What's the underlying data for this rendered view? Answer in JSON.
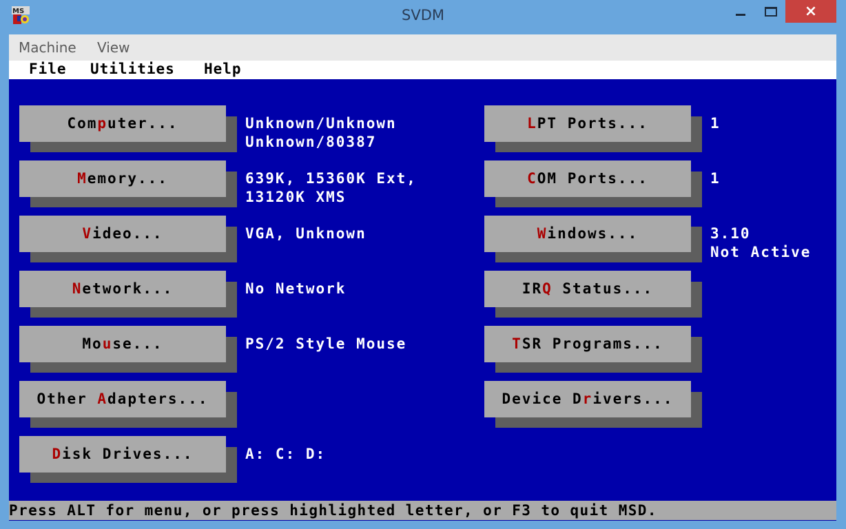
{
  "window": {
    "title": "SVDM",
    "icon": "msd-app-icon",
    "controls": {
      "minimize": "minimize-icon",
      "maximize": "maximize-icon",
      "close": "×"
    }
  },
  "host_menu": [
    {
      "label": "Machine"
    },
    {
      "label": "View"
    }
  ],
  "dos_menu": [
    {
      "label": "File"
    },
    {
      "label": "Utilities"
    },
    {
      "label": "Help"
    }
  ],
  "left_buttons": [
    {
      "pre": "Com",
      "hotkey": "p",
      "post": "uter...",
      "info": "Unknown/Unknown\nUnknown/80387"
    },
    {
      "pre": "",
      "hotkey": "M",
      "post": "emory...",
      "info": "639K, 15360K Ext,\n13120K XMS"
    },
    {
      "pre": "",
      "hotkey": "V",
      "post": "ideo...",
      "info": "VGA, Unknown"
    },
    {
      "pre": "",
      "hotkey": "N",
      "post": "etwork...",
      "info": "No Network"
    },
    {
      "pre": "Mo",
      "hotkey": "u",
      "post": "se...",
      "info": "PS/2 Style Mouse"
    },
    {
      "pre": "Other ",
      "hotkey": "A",
      "post": "dapters...",
      "info": ""
    },
    {
      "pre": "",
      "hotkey": "D",
      "post": "isk Drives...",
      "info": "A: C: D:"
    }
  ],
  "right_buttons": [
    {
      "pre": "",
      "hotkey": "L",
      "post": "PT Ports...",
      "info": "1"
    },
    {
      "pre": "",
      "hotkey": "C",
      "post": "OM Ports...",
      "info": "1"
    },
    {
      "pre": "",
      "hotkey": "W",
      "post": "indows...",
      "info": "3.10\nNot Active"
    },
    {
      "pre": "IR",
      "hotkey": "Q",
      "post": " Status...",
      "info": ""
    },
    {
      "pre": "",
      "hotkey": "T",
      "post": "SR Programs...",
      "info": ""
    },
    {
      "pre": "Device D",
      "hotkey": "r",
      "post": "ivers...",
      "info": ""
    }
  ],
  "status_bar": "Press ALT for menu, or press highlighted letter, or F3 to quit MSD.",
  "colors": {
    "background": "#0000aa",
    "button": "#aaaaaa",
    "shadow": "#5e5e5e",
    "hotkey": "#aa0000",
    "info_text": "#ffffff",
    "frame": "#69a6dd",
    "close": "#c8423f"
  }
}
